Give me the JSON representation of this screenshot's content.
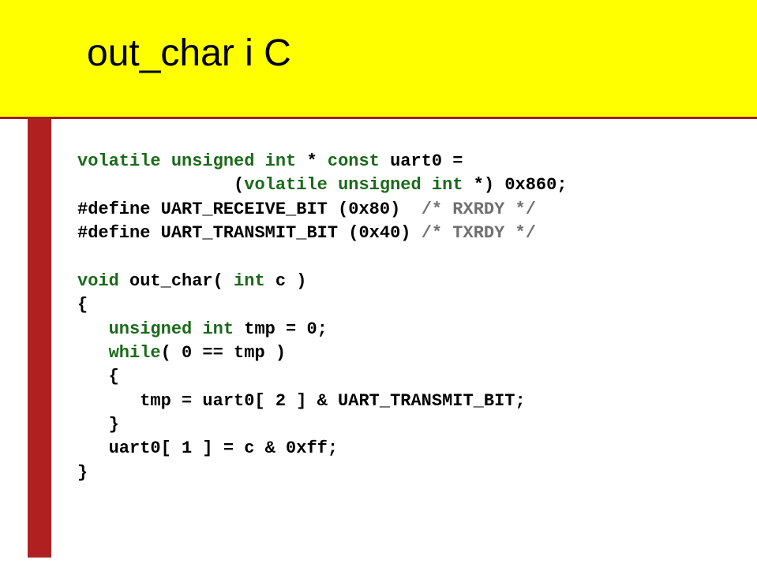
{
  "title": "out_char i C",
  "code": {
    "l1_kw1": "volatile",
    "l1_kw2": "unsigned",
    "l1_kw3": "int",
    "l1_kw4": "const",
    "l1_rest": " uart0 =",
    "l2_pad": "               ",
    "l2_p1": "(",
    "l2_kw1": "volatile",
    "l2_kw2": "unsigned",
    "l2_kw3": "int",
    "l2_rest": " *) 0x860;",
    "l3_pp": "#define",
    "l3_body": " UART_RECEIVE_BIT (0x80)  ",
    "l3_comm": "/* RXRDY */",
    "l4_pp": "#define",
    "l4_body": " UART_TRANSMIT_BIT (0x40) ",
    "l4_comm": "/* TXRDY */",
    "blank1": "",
    "l5_kw1": "void",
    "l5_mid": " out_char( ",
    "l5_kw2": "int",
    "l5_rest": " c )",
    "l6": "{",
    "l7_pad": "   ",
    "l7_kw1": "unsigned",
    "l7_kw2": "int",
    "l7_rest": " tmp = 0;",
    "l8_pad": "   ",
    "l8_kw1": "while",
    "l8_rest": "( 0 == tmp )",
    "l9": "   {",
    "l10": "      tmp = uart0[ 2 ] & UART_TRANSMIT_BIT;",
    "l11": "   }",
    "l12": "   uart0[ 1 ] = c & 0xff;",
    "l13": "}"
  }
}
